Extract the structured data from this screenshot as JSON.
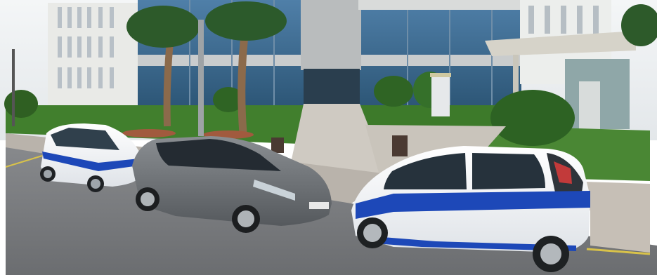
{
  "photo": {
    "subject": "",
    "colors": {
      "sky": "#eef1f3",
      "building": "#e6e7e4",
      "glass": "#3d6f98",
      "lawn": "#3f7d2e",
      "asphalt": "#7d7f83",
      "path": "#cfc9c1",
      "white_car": "#f4f6f8",
      "blue_stripe": "#1d48b8",
      "grey_car": "#6e7276"
    }
  }
}
